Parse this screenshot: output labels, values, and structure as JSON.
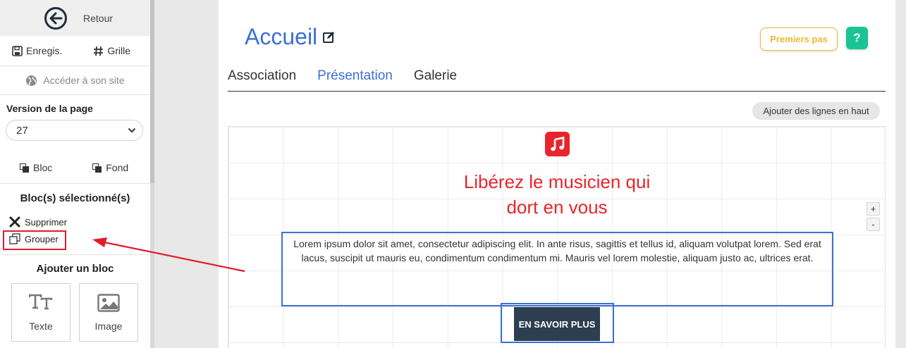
{
  "sidebar": {
    "back_label": "Retour",
    "save_label": "Enregis.",
    "grid_label": "Grille",
    "site_label": "Accéder à son site",
    "version_title": "Version de la page",
    "version_value": "27",
    "bloc_label": "Bloc",
    "fond_label": "Fond",
    "selected_title": "Bloc(s) sélectionné(s)",
    "delete_label": "Supprimer",
    "group_label": "Grouper",
    "add_title": "Ajouter un bloc",
    "tiles": [
      {
        "label": "Texte",
        "icon": "text-icon"
      },
      {
        "label": "Image",
        "icon": "image-icon"
      }
    ]
  },
  "main": {
    "title": "Accueil",
    "premiers_pas": "Premiers pas",
    "help": "?",
    "tabs": [
      {
        "label": "Association",
        "active": false
      },
      {
        "label": "Présentation",
        "active": true
      },
      {
        "label": "Galerie",
        "active": false
      }
    ],
    "add_lines": "Ajouter des lignes en haut",
    "headline_1": "Libérez le musicien qui",
    "headline_2": "dort en vous",
    "plus": "+",
    "minus": "-",
    "lorem": "Lorem ipsum dolor sit amet, consectetur adipiscing elit. In ante risus, sagittis et tellus id, aliquam volutpat lorem. Sed erat lacus, suscipit ut mauris eu, condimentum condimentum mi. Mauris vel lorem molestie, aliquam justo ac, ultrices erat.",
    "cta": "EN SAVOIR PLUS"
  },
  "colors": {
    "accent_blue": "#3b6fd8",
    "headline_red": "#e8252c",
    "highlight_red": "#e21b2b",
    "help_green": "#1bc495",
    "premiers_yellow": "#f0b732",
    "cta_dark": "#2c3e50"
  }
}
